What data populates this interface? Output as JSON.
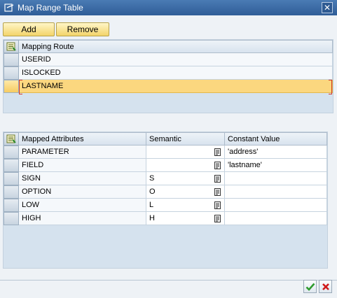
{
  "window": {
    "title": "Map Range Table",
    "close_glyph": "✕"
  },
  "toolbar": {
    "add_label": "Add",
    "remove_label": "Remove"
  },
  "route_table": {
    "header": "Mapping Route",
    "rows": [
      {
        "value": "USERID"
      },
      {
        "value": "ISLOCKED"
      },
      {
        "value": "LASTNAME",
        "selected": true
      }
    ]
  },
  "attr_table": {
    "headers": {
      "attribute": "Mapped Attributes",
      "semantic": "Semantic",
      "constant": "Constant Value"
    },
    "rows": [
      {
        "attribute": "PARAMETER",
        "semantic": "",
        "constant": "'address'"
      },
      {
        "attribute": "FIELD",
        "semantic": "",
        "constant": "'lastname'"
      },
      {
        "attribute": "SIGN",
        "semantic": "S",
        "constant": ""
      },
      {
        "attribute": "OPTION",
        "semantic": "O",
        "constant": ""
      },
      {
        "attribute": "LOW",
        "semantic": "L",
        "constant": ""
      },
      {
        "attribute": "HIGH",
        "semantic": "H",
        "constant": ""
      }
    ]
  },
  "icons": {
    "table_settings": "table-settings-icon",
    "value_help": "value-help-icon",
    "ok": "check-icon",
    "cancel": "cancel-icon"
  },
  "colors": {
    "title_bar": "#2f5d97",
    "button_yellow": "#f3d46a",
    "highlight_row": "#fbd77f",
    "ok_green": "#2e9b2e",
    "cancel_red": "#d01a1a"
  }
}
